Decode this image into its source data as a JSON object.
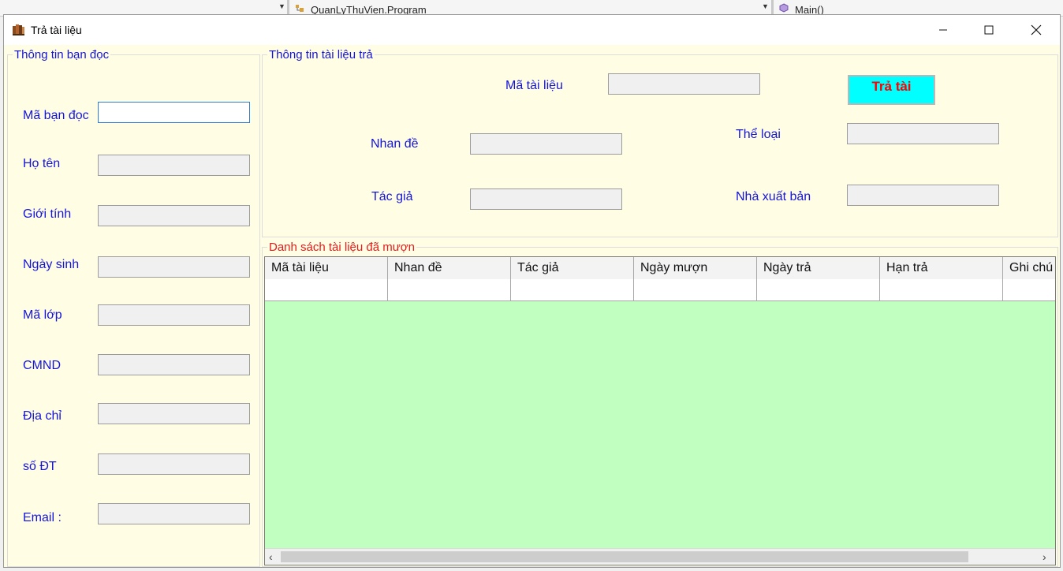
{
  "ide": {
    "project_dropdown": "QuanLyThuVien.Program",
    "method_dropdown": "Main()"
  },
  "window": {
    "title": "Trả tài liệu",
    "minimize_glyph": "—",
    "maximize_glyph": "☐",
    "close_glyph": "✕"
  },
  "reader_group": {
    "title": "Thông tin bạn đọc",
    "fields": [
      {
        "label": "Mã bạn đọc",
        "value": ""
      },
      {
        "label": "Họ tên",
        "value": ""
      },
      {
        "label": "Giới tính",
        "value": ""
      },
      {
        "label": "Ngày sinh",
        "value": ""
      },
      {
        "label": "Mã lớp",
        "value": ""
      },
      {
        "label": "CMND",
        "value": ""
      },
      {
        "label": "Địa chỉ",
        "value": ""
      },
      {
        "label": "số ĐT",
        "value": ""
      },
      {
        "label": "Email :",
        "value": ""
      }
    ]
  },
  "doc_group": {
    "title": "Thông tin tài liệu trả",
    "ma_tai_lieu": {
      "label": "Mã tài liệu",
      "value": ""
    },
    "nhan_de": {
      "label": "Nhan đề",
      "value": ""
    },
    "tac_gia": {
      "label": "Tác giả",
      "value": ""
    },
    "the_loai": {
      "label": "Thể loại",
      "value": ""
    },
    "nha_xuat_ban": {
      "label": "Nhà xuất bản",
      "value": ""
    },
    "return_button": "Trả tài"
  },
  "borrowed_group": {
    "title": "Danh sách tài liệu đã mượn",
    "columns": [
      "Mã tài liệu",
      "Nhan đề",
      "Tác giả",
      "Ngày mượn",
      "Ngày trả",
      "Hạn trả",
      "Ghi chú"
    ],
    "rows": [
      [
        "",
        "",
        "",
        "",
        "",
        "",
        ""
      ]
    ],
    "scroll_left": "‹",
    "scroll_right": "›"
  },
  "colors": {
    "form_background": "#fffde4",
    "label_text": "#1515d8",
    "list_title": "#e21d1d",
    "grid_background": "#c0ffc0",
    "button_background": "#00ffff",
    "button_text": "#ff0000"
  },
  "icons": {
    "app_icon": "books-icon",
    "project_icon": "class-icon",
    "method_icon": "method-cube-icon"
  }
}
